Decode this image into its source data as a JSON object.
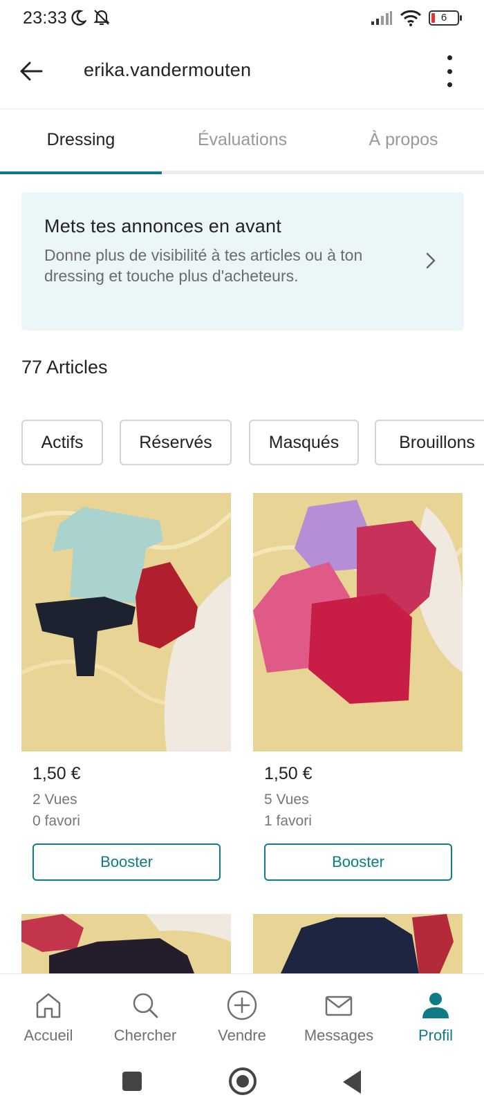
{
  "status_bar": {
    "time": "23:33",
    "icons": [
      "moon-icon",
      "alarm-off-icon",
      "signal-icon",
      "wifi-icon",
      "battery-icon"
    ],
    "battery_level": "6"
  },
  "header": {
    "back_icon": "arrow-left-icon",
    "title": "erika.vandermouten",
    "more_icon": "more-vertical-icon"
  },
  "tabs": [
    {
      "label": "Dressing",
      "active": true
    },
    {
      "label": "Évaluations",
      "active": false
    },
    {
      "label": "À propos",
      "active": false
    }
  ],
  "promo": {
    "title": "Mets tes annonces en avant",
    "text": "Donne plus de visibilité à tes articles ou à ton dressing et touche plus d'acheteurs.",
    "chevron_icon": "chevron-right-icon"
  },
  "articles": {
    "count_label": "77 Articles"
  },
  "filters": [
    "Actifs",
    "Réservés",
    "Masqués",
    "Brouillons"
  ],
  "items": [
    {
      "price": "1,50 €",
      "views": "2 Vues",
      "favorites": "0 favori",
      "button": "Booster"
    },
    {
      "price": "1,50 €",
      "views": "5 Vues",
      "favorites": "1 favori",
      "button": "Booster"
    }
  ],
  "bottom_nav": [
    {
      "label": "Accueil",
      "icon": "home-icon",
      "active": false
    },
    {
      "label": "Chercher",
      "icon": "search-icon",
      "active": false
    },
    {
      "label": "Vendre",
      "icon": "plus-circle-icon",
      "active": false
    },
    {
      "label": "Messages",
      "icon": "mail-icon",
      "active": false
    },
    {
      "label": "Profil",
      "icon": "user-icon",
      "active": true
    }
  ],
  "colors": {
    "accent": "#0d7c86",
    "promo_background": "#eaf6f7",
    "muted_text": "#777777"
  }
}
